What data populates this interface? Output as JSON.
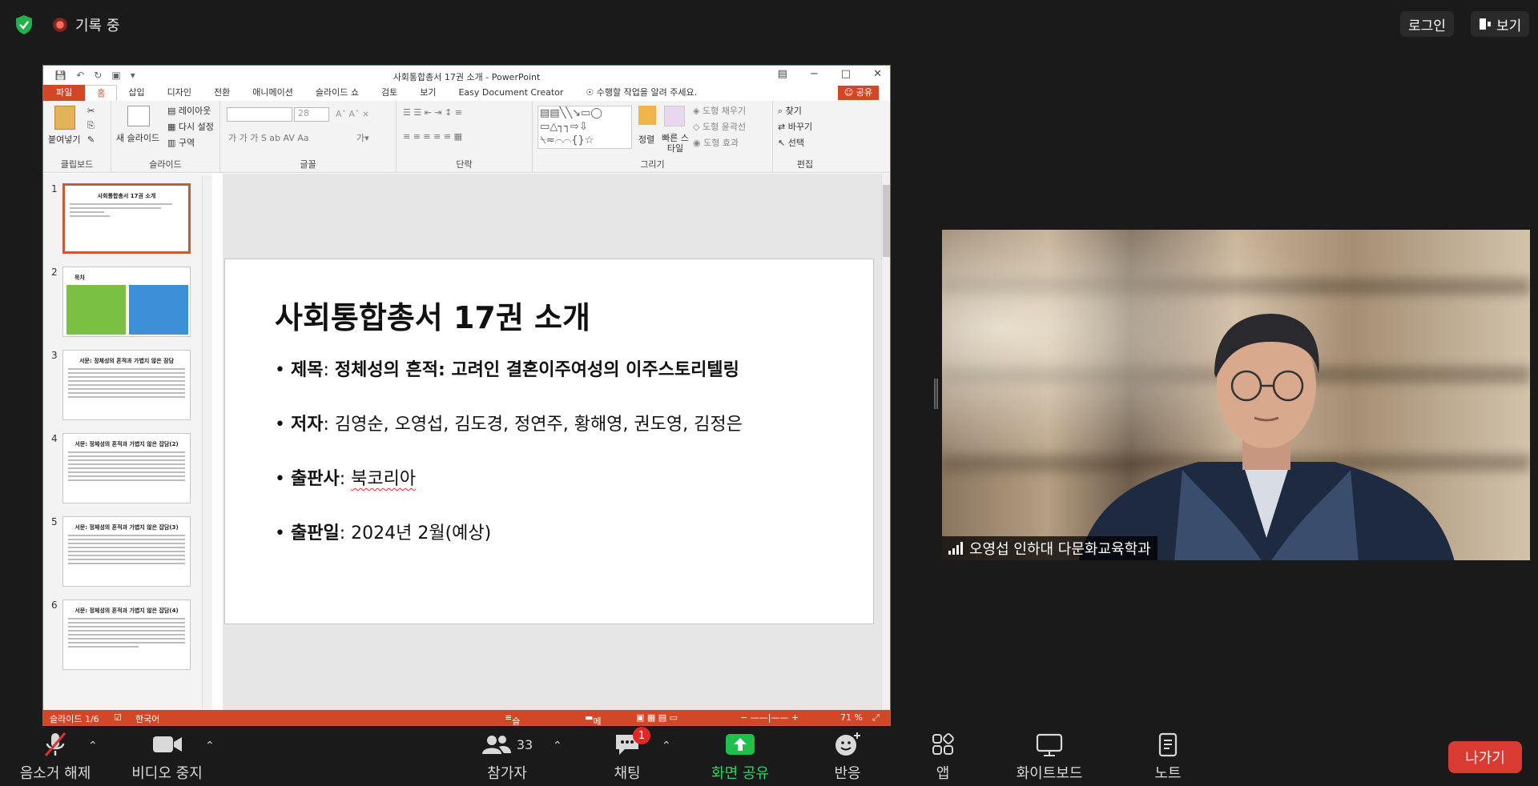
{
  "zoom_top": {
    "recording_label": "기록 중",
    "login_label": "로그인",
    "view_label": "보기"
  },
  "ppt": {
    "window_title": "사회통합총서 17권 소개 - PowerPoint",
    "tabs": [
      "파일",
      "홈",
      "삽입",
      "디자인",
      "전환",
      "애니메이션",
      "슬라이드 쇼",
      "검토",
      "보기",
      "Easy Document Creator"
    ],
    "tell_me": "수행할 작업을 알려 주세요.",
    "share_label": "공유",
    "ribbon": {
      "paste": "붙여넣기",
      "new_slide": "새 슬라이드",
      "layout": "레이아웃",
      "reset": "다시 설정",
      "section": "구역",
      "font_size": "28",
      "arrange": "정렬",
      "quick_styles": "빠른 스타일",
      "shape_fill": "도형 채우기",
      "shape_outline": "도형 윤곽선",
      "shape_effects": "도형 효과",
      "find": "찾기",
      "replace": "바꾸기",
      "select": "선택",
      "groups": {
        "clipboard": "클립보드",
        "slides": "슬라이드",
        "font": "글꼴",
        "paragraph": "단락",
        "drawing": "그리기",
        "editing": "편집"
      }
    },
    "thumbnails": [
      {
        "num": "1",
        "title": "사회통합총서 17권 소개"
      },
      {
        "num": "2",
        "title": "목차"
      },
      {
        "num": "3",
        "title": "서문: 정체성의 흔적과 가볍지 않은 잠담"
      },
      {
        "num": "4",
        "title": "서문: 정체성의 흔적과 가볍지 않은 잡담(2)"
      },
      {
        "num": "5",
        "title": "서문: 정체성의 흔적과 가볍지 않은 잡담(3)"
      },
      {
        "num": "6",
        "title": "서문: 정체성의 흔적과 가볍지 않은 잡담(4)"
      }
    ],
    "slide": {
      "title": "사회통합총서 17권 소개",
      "b1_label": "제목",
      "b1_value": "정체성의 흔적: 고려인 결혼이주여성의 이주스토리텔링",
      "b2_label": "저자",
      "b2_value": "김영순, 오영섭, 김도경, 정연주, 황해영, 권도영, 김정은",
      "b3_label": "출판사",
      "b3_value": "북코리아",
      "b4_label": "출판일",
      "b4_value": "2024년 2월(예상)"
    },
    "status": {
      "slide_pos": "슬라이드 1/6",
      "language": "한국어",
      "notes": "슬라이드 노트",
      "comments": "메모",
      "zoom": "71 %"
    }
  },
  "video": {
    "participant_name": "오영섭 인하대 다문화교육학과"
  },
  "toolbar": {
    "unmute": "음소거 해제",
    "stop_video": "비디오 중지",
    "participants": "참가자",
    "participants_count": "33",
    "chat": "채팅",
    "chat_badge": "1",
    "share_screen": "화면 공유",
    "reactions": "반응",
    "apps": "앱",
    "whiteboard": "화이트보드",
    "notes": "노트",
    "leave": "나가기"
  },
  "colors": {
    "ppt_accent": "#d24726",
    "share_green": "#1fbf4b",
    "leave_red": "#d93a32",
    "shield_green": "#22b04b"
  }
}
